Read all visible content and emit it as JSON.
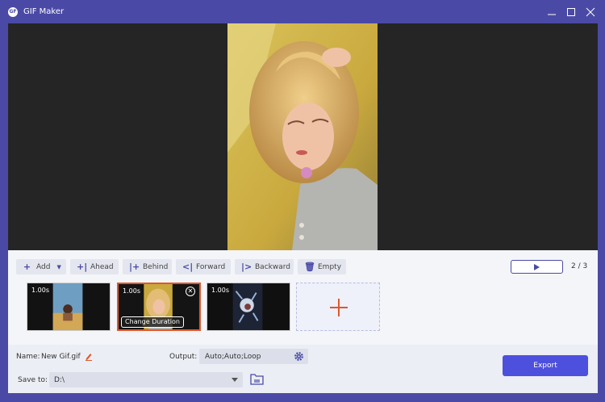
{
  "window": {
    "title": "GIF Maker",
    "app_icon_text": "GF",
    "accent_color": "#4a4aa6"
  },
  "toolbar": {
    "add_label": "Add",
    "ahead_label": "Ahead",
    "behind_label": "Behind",
    "forward_label": "Forward",
    "backward_label": "Backward",
    "empty_label": "Empty"
  },
  "player": {
    "current": "2",
    "separator": "/",
    "total": "3"
  },
  "frames": [
    {
      "duration": "1.00s"
    },
    {
      "duration": "1.00s",
      "selected": true,
      "change_label": "Change Duration"
    },
    {
      "duration": "1.00s"
    }
  ],
  "settings": {
    "name_label": "Name:",
    "name_value": "New Gif.gif",
    "output_label": "Output:",
    "output_value": "Auto;Auto;Loop",
    "save_label": "Save to:",
    "save_value": "D:\\",
    "export_label": "Export",
    "export_color": "#4d50dd",
    "highlight_color": "#e0572a"
  }
}
